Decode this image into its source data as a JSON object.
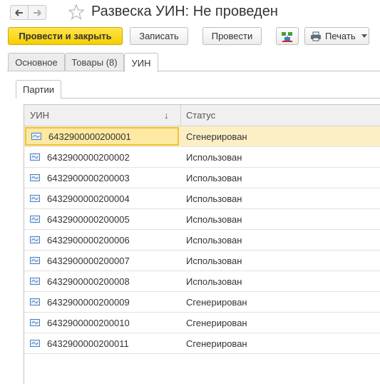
{
  "window": {
    "title": "Развеска УИН: Не проведен"
  },
  "toolbar": {
    "post_and_close": "Провести и закрыть",
    "save": "Записать",
    "post": "Провести",
    "print": "Печать"
  },
  "tabs": [
    {
      "label": "Основное"
    },
    {
      "label": "Товары (8)"
    },
    {
      "label": "УИН"
    }
  ],
  "subtab": {
    "label": "Партии"
  },
  "table": {
    "columns": {
      "uin": "УИН",
      "status": "Статус",
      "sort_indicator": "↓"
    },
    "rows": [
      {
        "uin": "6432900000200001",
        "status": "Сгенерирован"
      },
      {
        "uin": "6432900000200002",
        "status": "Использован"
      },
      {
        "uin": "6432900000200003",
        "status": "Использован"
      },
      {
        "uin": "6432900000200004",
        "status": "Использован"
      },
      {
        "uin": "6432900000200005",
        "status": "Использован"
      },
      {
        "uin": "6432900000200006",
        "status": "Использован"
      },
      {
        "uin": "6432900000200007",
        "status": "Использован"
      },
      {
        "uin": "6432900000200008",
        "status": "Использован"
      },
      {
        "uin": "6432900000200009",
        "status": "Сгенерирован"
      },
      {
        "uin": "6432900000200010",
        "status": "Сгенерирован"
      },
      {
        "uin": "6432900000200011",
        "status": "Сгенерирован"
      }
    ]
  },
  "colors": {
    "primary_button": "#f5cf00",
    "selected_row": "#fbefc3",
    "selected_cell_border": "#f0c23d"
  },
  "icons": [
    "back-arrow-icon",
    "forward-arrow-icon",
    "favorite-star-icon",
    "structure-icon",
    "printer-icon",
    "dropdown-arrow-icon",
    "uin-record-icon"
  ]
}
